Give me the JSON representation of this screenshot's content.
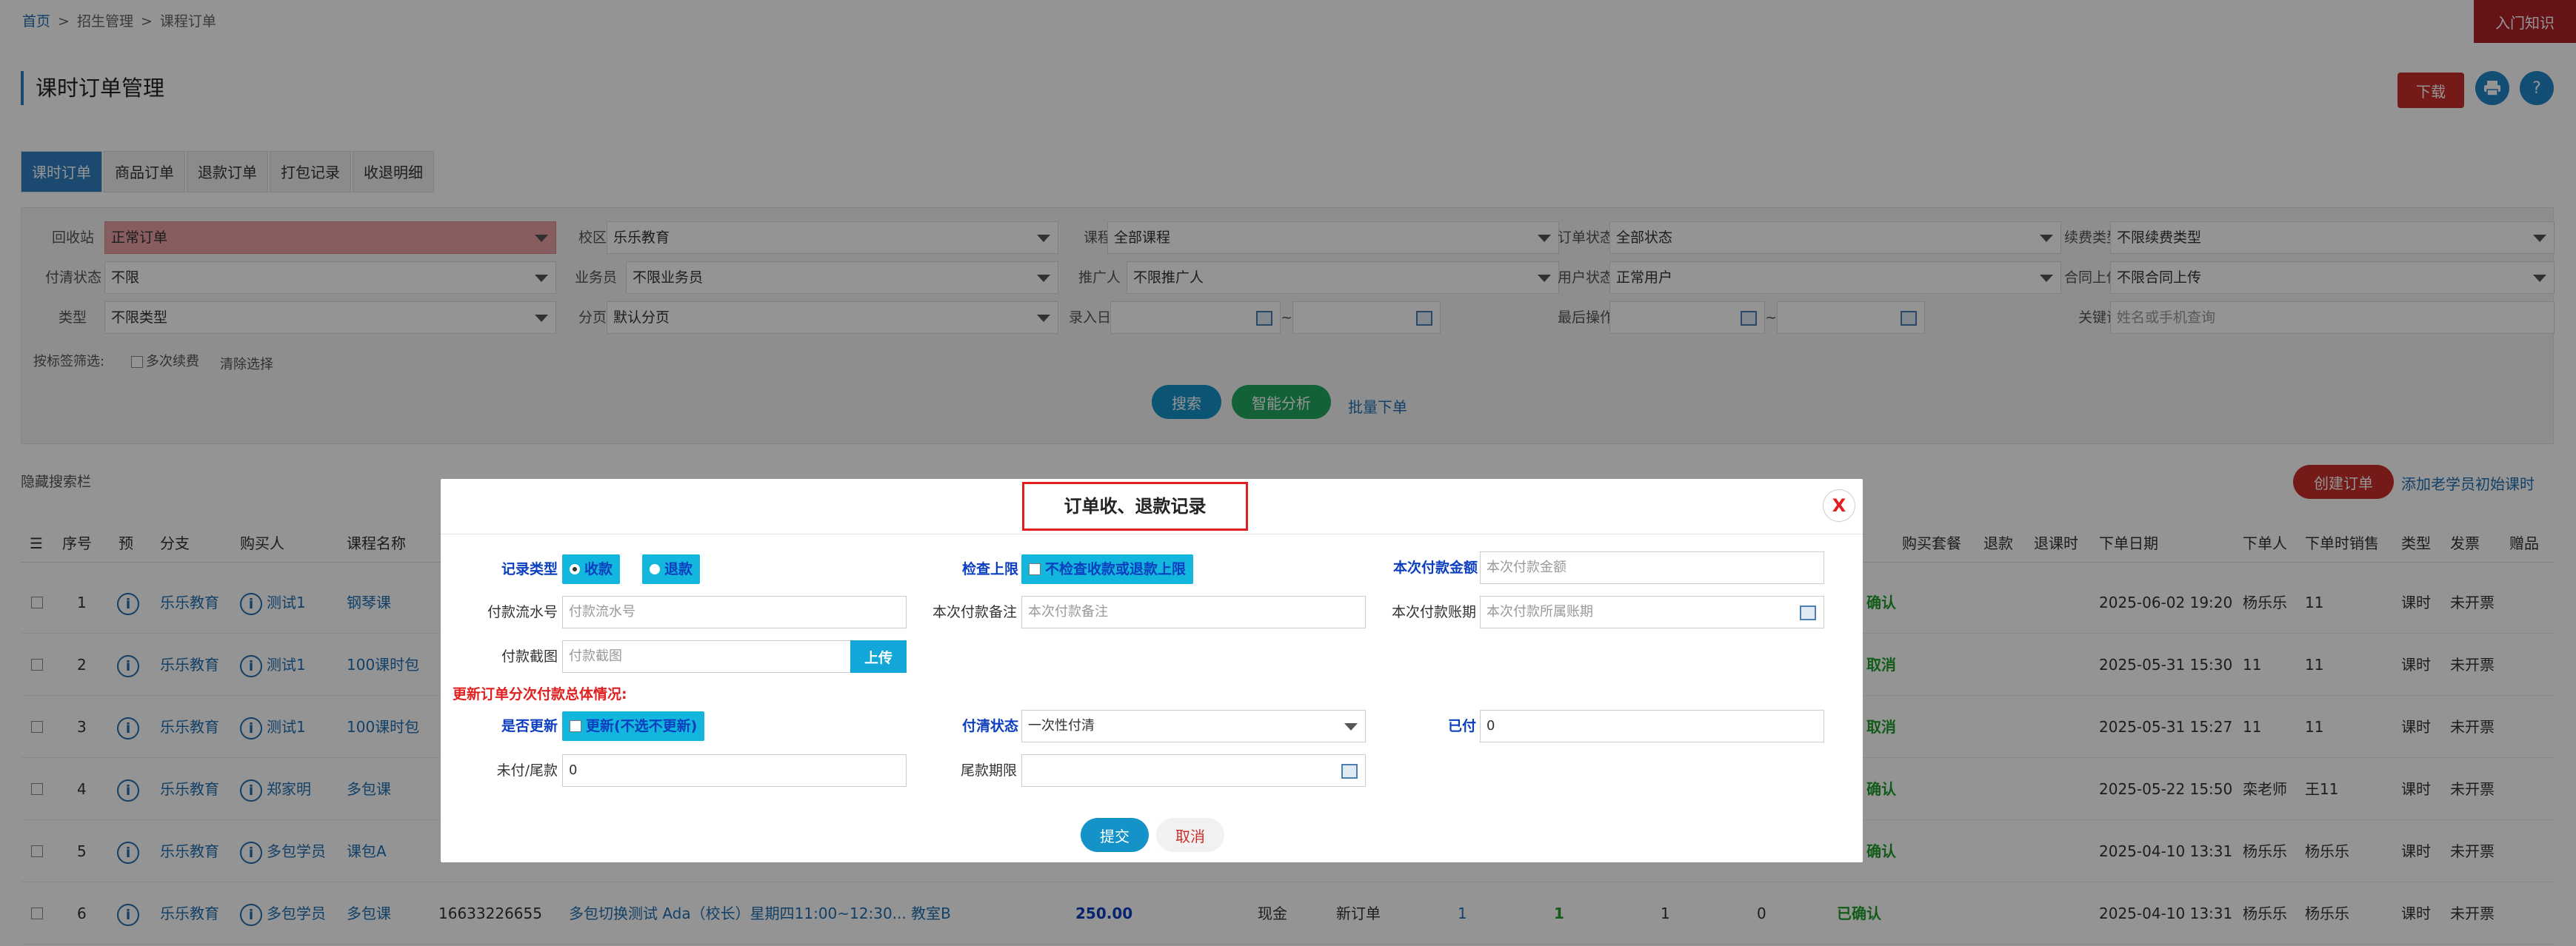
{
  "breadcrumb": {
    "home": "首页",
    "sep": ">",
    "level2": "招生管理",
    "level3": "课程订单"
  },
  "top_button": "入门知识",
  "page_title": "课时订单管理",
  "download_label": "下载",
  "print_icon": "print-icon",
  "help_label": "?",
  "tabs": [
    "课时订单",
    "商品订单",
    "退款订单",
    "打包记录",
    "收退明细"
  ],
  "filters": {
    "row1": [
      {
        "label": "回收站",
        "value": "正常订单"
      },
      {
        "label": "校区",
        "value": "乐乐教育"
      },
      {
        "label": "课程",
        "value": "全部课程"
      },
      {
        "label": "订单状态",
        "value": "全部状态"
      },
      {
        "label": "续费类型",
        "value": "不限续费类型"
      }
    ],
    "row2": [
      {
        "label": "付清状态",
        "value": "不限"
      },
      {
        "label": "业务员",
        "value": "不限业务员"
      },
      {
        "label": "推广人",
        "value": "不限推广人"
      },
      {
        "label": "用户状态",
        "value": "正常用户"
      },
      {
        "label": "合同上传",
        "value": "不限合同上传"
      }
    ],
    "row3": [
      {
        "label": "类型",
        "value": "不限类型"
      },
      {
        "label": "分页",
        "value": "默认分页"
      },
      {
        "label": "录入日期",
        "value": ""
      },
      {
        "label": "最后操作",
        "value": ""
      },
      {
        "label": "关键词",
        "placeholder": "姓名或手机查询"
      }
    ],
    "tilde": "~",
    "tag_filter_label": "按标签筛选:",
    "multi_renew": "多次续费",
    "clear": "清除选择"
  },
  "search_label": "搜索",
  "smart_label": "智能分析",
  "batch_label": "批量下单",
  "hide_search": "隐藏搜索栏",
  "create_order": "创建订单",
  "add_old": "添加老学员初始课时",
  "columns": [
    "序号",
    "预",
    "分支",
    "购买人",
    "课程名称",
    "购买套餐",
    "退款",
    "退课时",
    "下单日期",
    "下单人",
    "下单时销售",
    "类型",
    "发票",
    "赠品"
  ],
  "rows": [
    {
      "no": "1",
      "branch": "乐乐教育",
      "buyer": "测试1",
      "course": "钢琴课",
      "status": "确认",
      "date": "2025-06-02 19:20",
      "by": "杨乐乐",
      "sales": "11",
      "type": "课时",
      "invoice": "未开票"
    },
    {
      "no": "2",
      "branch": "乐乐教育",
      "buyer": "测试1",
      "course": "100课时包",
      "status": "取消",
      "date": "2025-05-31 15:30",
      "by": "11",
      "sales": "11",
      "type": "课时",
      "invoice": "未开票"
    },
    {
      "no": "3",
      "branch": "乐乐教育",
      "buyer": "测试1",
      "course": "100课时包",
      "status": "取消",
      "date": "2025-05-31 15:27",
      "by": "11",
      "sales": "11",
      "type": "课时",
      "invoice": "未开票"
    },
    {
      "no": "4",
      "branch": "乐乐教育",
      "buyer": "郑家明",
      "course": "多包课",
      "status": "确认",
      "date": "2025-05-22 15:50",
      "by": "栾老师",
      "sales": "王11",
      "type": "课时",
      "invoice": "未开票"
    },
    {
      "no": "5",
      "branch": "乐乐教育",
      "buyer": "多包学员",
      "course": "课包A",
      "status": "确认",
      "date": "2025-04-10 13:31",
      "by": "杨乐乐",
      "sales": "杨乐乐",
      "type": "课时",
      "invoice": "未开票"
    },
    {
      "no": "6",
      "branch": "乐乐教育",
      "buyer": "多包学员",
      "course": "多包课",
      "phone": "16633226655",
      "desc": "多包切换测试 Ada（校长）星期四11:00~12:30... 教室B",
      "amount": "250.00",
      "pay": "现金",
      "order_type": "新订单",
      "c1": "1",
      "c2": "1",
      "c3": "1",
      "c4": "0",
      "status": "已确认",
      "date": "2025-04-10 13:31",
      "by": "杨乐乐",
      "sales": "杨乐乐",
      "type": "课时",
      "invoice": "未开票"
    }
  ],
  "modal": {
    "title": "订单收、退款记录",
    "close": "X",
    "record_type_label": "记录类型",
    "record_in": "收款",
    "record_out": "退款",
    "check_limit_label": "检查上限",
    "check_limit_option": "不检查收款或退款上限",
    "amount_label": "本次付款金额",
    "amount_placeholder": "本次付款金额",
    "serial_label": "付款流水号",
    "serial_placeholder": "付款流水号",
    "note_label": "本次付款备注",
    "note_placeholder": "本次付款备注",
    "period_label": "本次付款账期",
    "period_placeholder": "本次付款所属账期",
    "screenshot_label": "付款截图",
    "screenshot_placeholder": "付款截图",
    "upload": "上传",
    "update_warning": "更新订单分次付款总体情况:",
    "update_label": "是否更新",
    "update_option": "更新(不选不更新)",
    "settle_label": "付清状态",
    "settle_value": "一次性付清",
    "paid_label": "已付",
    "paid_value": "0",
    "unpaid_label": "未付/尾款",
    "unpaid_value": "0",
    "due_label": "尾款期限",
    "submit": "提交",
    "cancel": "取消"
  }
}
